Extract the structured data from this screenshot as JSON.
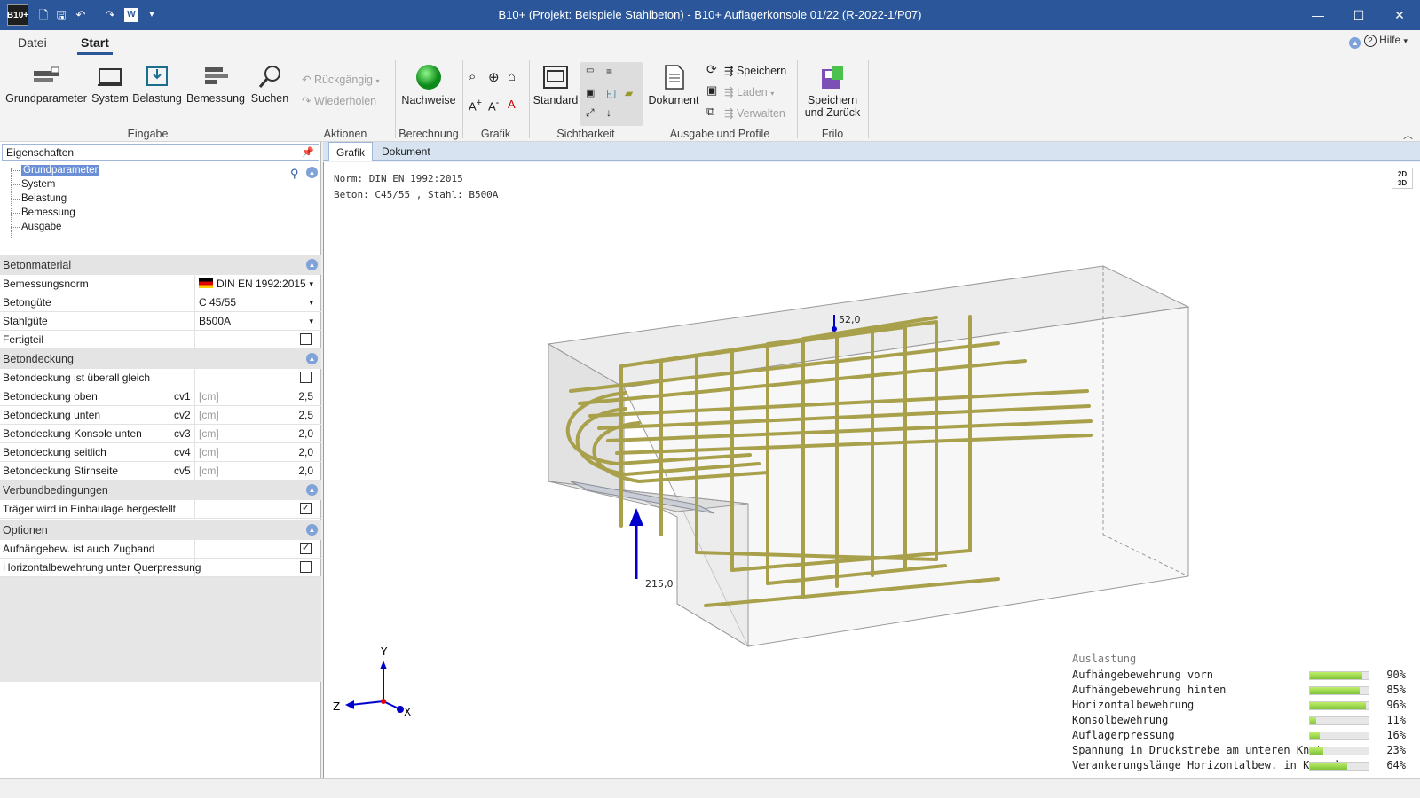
{
  "titlebar": {
    "logo": "B10+",
    "title": "B10+ (Projekt: Beispiele Stahlbeton) - B10+ Auflagerkonsole 01/22 (R-2022-1/P07)"
  },
  "menu_tabs": [
    "Datei",
    "Start"
  ],
  "help_label": "Hilfe",
  "ribbon": {
    "eingabe": [
      "Grundparameter",
      "System",
      "Belastung",
      "Bemessung",
      "Suchen"
    ],
    "aktionen": {
      "undo": "Rückgängig",
      "redo": "Wiederholen"
    },
    "nachweise": "Nachweise",
    "standard": "Standard",
    "dokument": "Dokument",
    "speichern": "Speichern",
    "laden": "Laden",
    "verwalten": "Verwalten",
    "speichern_zurueck": "Speichern und Zurück",
    "groups": [
      "Eingabe",
      "Aktionen",
      "Berechnung",
      "Grafik",
      "Sichtbarkeit",
      "Ausgabe und Profile",
      "Frilo"
    ]
  },
  "panel": {
    "title": "Eigenschaften",
    "tree": [
      "Grundparameter",
      "System",
      "Belastung",
      "Bemessung",
      "Ausgabe"
    ],
    "sections": {
      "betonmaterial": "Betonmaterial",
      "betondeckung": "Betondeckung",
      "verbund": "Verbundbedingungen",
      "optionen": "Optionen"
    },
    "material": [
      {
        "label": "Bemessungsnorm",
        "value": "DIN EN 1992:2015"
      },
      {
        "label": "Betongüte",
        "value": "C 45/55"
      },
      {
        "label": "Stahlgüte",
        "value": "B500A"
      },
      {
        "label": "Fertigteil",
        "value": ""
      }
    ],
    "cover_same": "Betondeckung ist überall gleich",
    "cover": [
      {
        "label": "Betondeckung oben",
        "sym": "cv1",
        "unit": "[cm]",
        "value": "2,5"
      },
      {
        "label": "Betondeckung unten",
        "sym": "cv2",
        "unit": "[cm]",
        "value": "2,5"
      },
      {
        "label": "Betondeckung Konsole unten",
        "sym": "cv3",
        "unit": "[cm]",
        "value": "2,0"
      },
      {
        "label": "Betondeckung seitlich",
        "sym": "cv4",
        "unit": "[cm]",
        "value": "2,0"
      },
      {
        "label": "Betondeckung Stirnseite",
        "sym": "cv5",
        "unit": "[cm]",
        "value": "2,0"
      }
    ],
    "verbund_row": "Träger wird in Einbaulage hergestellt",
    "opt1": "Aufhängebew. ist auch Zugband",
    "opt2": "Horizontalbewehrung unter Querpressung"
  },
  "view_tabs": [
    "Grafik",
    "Dokument"
  ],
  "graphic": {
    "norm": "Norm: DIN EN 1992:2015",
    "material": "Beton: C45/55 , Stahl: B500A",
    "load_top": "52,0",
    "load_bottom": "215,0",
    "axes": {
      "x": "X",
      "y": "Y",
      "z": "Z"
    },
    "view_toggle_2d": "2D",
    "view_toggle_3d": "3D"
  },
  "usage": {
    "title": "Auslastung",
    "rows": [
      {
        "label": "Aufhängebewehrung vorn",
        "pct": "90%",
        "value": 90
      },
      {
        "label": "Aufhängebewehrung hinten",
        "pct": "85%",
        "value": 85
      },
      {
        "label": "Horizontalbewehrung",
        "pct": "96%",
        "value": 96
      },
      {
        "label": "Konsolbewehrung",
        "pct": "11%",
        "value": 11
      },
      {
        "label": "Auflagerpressung",
        "pct": "16%",
        "value": 16
      },
      {
        "label": "Spannung in Druckstrebe am unteren Knoten",
        "pct": "23%",
        "value": 23
      },
      {
        "label": "Verankerungslänge Horizontalbew. in Konsole",
        "pct": "64%",
        "value": 64
      }
    ]
  },
  "colors": {
    "accent": "#2b579a",
    "rebar": "#a8a04a",
    "load_arrow": "#0000cc"
  }
}
